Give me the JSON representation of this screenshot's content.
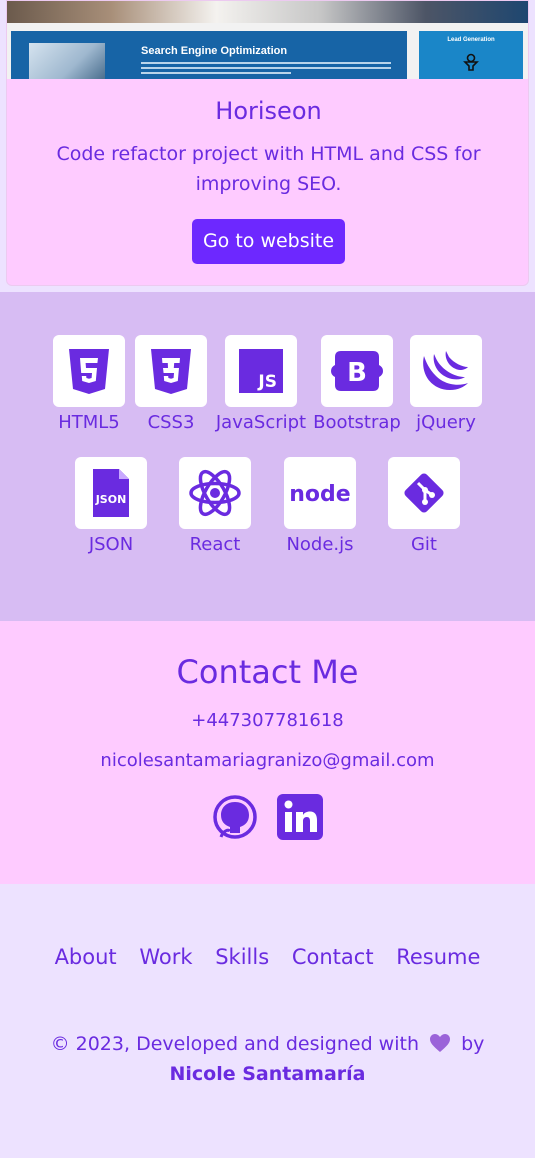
{
  "project": {
    "screenshot_caption_seo": "Search Engine Optimization",
    "screenshot_caption_lead": "Lead Generation",
    "title": "Horiseon",
    "description": "Code refactor project with HTML and CSS for improving SEO.",
    "button_label": "Go to website"
  },
  "skills": [
    {
      "label": "HTML5",
      "icon": "html5-icon"
    },
    {
      "label": "CSS3",
      "icon": "css3-icon"
    },
    {
      "label": "JavaScript",
      "icon": "javascript-icon"
    },
    {
      "label": "Bootstrap",
      "icon": "bootstrap-icon"
    },
    {
      "label": "jQuery",
      "icon": "jquery-icon"
    },
    {
      "label": "JSON",
      "icon": "json-icon"
    },
    {
      "label": "React",
      "icon": "react-icon"
    },
    {
      "label": "Node.js",
      "icon": "nodejs-icon"
    },
    {
      "label": "Git",
      "icon": "git-icon"
    }
  ],
  "contact": {
    "title": "Contact Me",
    "phone": "+447307781618",
    "email": "nicolesantamariagranizo@gmail.com",
    "socials": [
      "github-icon",
      "linkedin-icon"
    ]
  },
  "footer": {
    "nav": [
      "About",
      "Work",
      "Skills",
      "Contact",
      "Resume"
    ],
    "copyright_prefix": "© 2023, Developed and designed with",
    "copyright_by": "by",
    "author": "Nicole Santamaría"
  },
  "colors": {
    "accent": "#6a2be0",
    "button": "#6d28ff",
    "card_bg": "#fecbff",
    "skills_bg": "#d7bcf3",
    "page_bg": "#ede2ff"
  }
}
